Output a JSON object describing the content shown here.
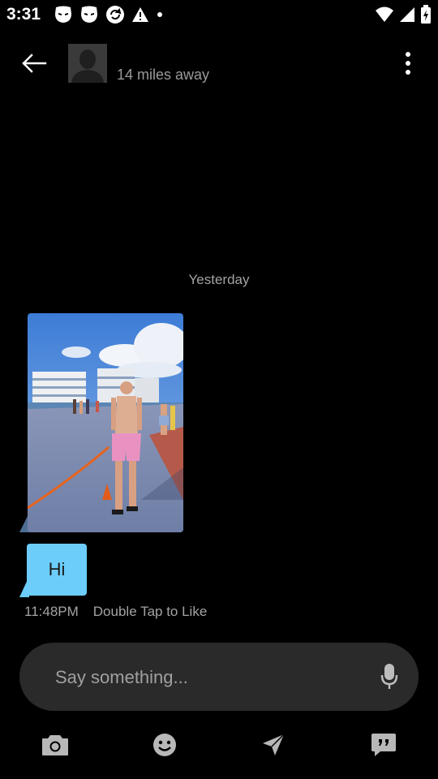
{
  "status_bar": {
    "time": "3:31",
    "left_icons": [
      "notification-app-icon",
      "notification-app-icon",
      "sync-app-icon",
      "warning-icon",
      "dot-icon"
    ],
    "right_icons": [
      "wifi-icon",
      "cell-signal-icon",
      "battery-icon"
    ]
  },
  "header": {
    "back_icon": "arrow-left-icon",
    "avatar": "profile-avatar",
    "distance": "14 miles away",
    "more_icon": "more-vertical-icon"
  },
  "conversation": {
    "date_divider": "Yesterday",
    "messages": [
      {
        "type": "photo",
        "description_icon": "photo-message"
      },
      {
        "type": "text",
        "text": "Hi",
        "time": "11:48PM",
        "hint": "Double Tap to Like"
      }
    ]
  },
  "composer": {
    "placeholder": "Say something...",
    "mic_icon": "microphone-icon"
  },
  "toolbar": {
    "items": [
      "camera-icon",
      "emoji-icon",
      "location-icon",
      "quick-phrases-icon"
    ]
  },
  "colors": {
    "background": "#000000",
    "bubble": "#6ccdfb",
    "input": "#2a2a2a",
    "muted_text": "#a3a3a3",
    "icon": "#b8b8b8"
  }
}
